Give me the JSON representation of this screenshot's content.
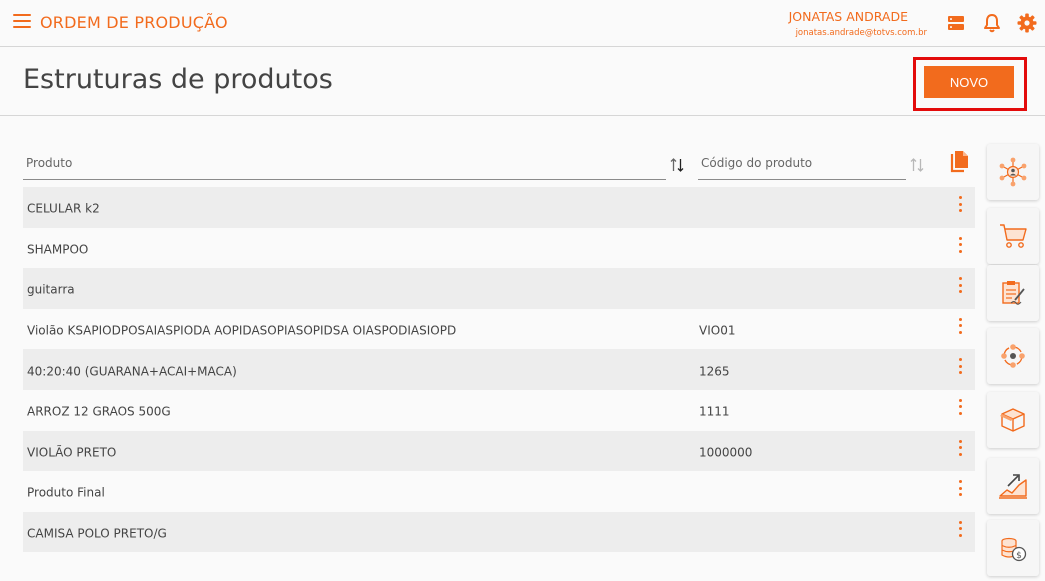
{
  "header": {
    "title": "ORDEM DE PRODUÇÃO",
    "user_name": "JONATAS ANDRADE",
    "user_email": "jonatas.andrade@totvs.com.br"
  },
  "page": {
    "title": "Estruturas de produtos",
    "new_button": "NOVO"
  },
  "filters": {
    "produto_placeholder": "Produto",
    "codigo_placeholder": "Código do produto"
  },
  "rows": [
    {
      "produto": "CELULAR k2",
      "codigo": ""
    },
    {
      "produto": "SHAMPOO",
      "codigo": ""
    },
    {
      "produto": "guitarra",
      "codigo": ""
    },
    {
      "produto": "Violão KSAPIODPOSAIASPIODA AOPIDASOPIASOPIDSA OIASPODIASIOPD",
      "codigo": "VIO01"
    },
    {
      "produto": "40:20:40 (GUARANA+ACAI+MACA)",
      "codigo": "1265"
    },
    {
      "produto": "ARROZ 12 GRAOS 500G",
      "codigo": "1111"
    },
    {
      "produto": "VIOLÃO PRETO",
      "codigo": "1000000"
    },
    {
      "produto": "Produto Final",
      "codigo": ""
    },
    {
      "produto": "CAMISA POLO PRETO/G",
      "codigo": ""
    }
  ],
  "side_icons": [
    "network-hub-icon",
    "cart-icon",
    "checklist-signature-icon",
    "cycle-process-icon",
    "box-icon",
    "growth-chart-icon",
    "coins-icon"
  ],
  "colors": {
    "accent": "#f26b1d",
    "highlight": "#e30b0b"
  }
}
